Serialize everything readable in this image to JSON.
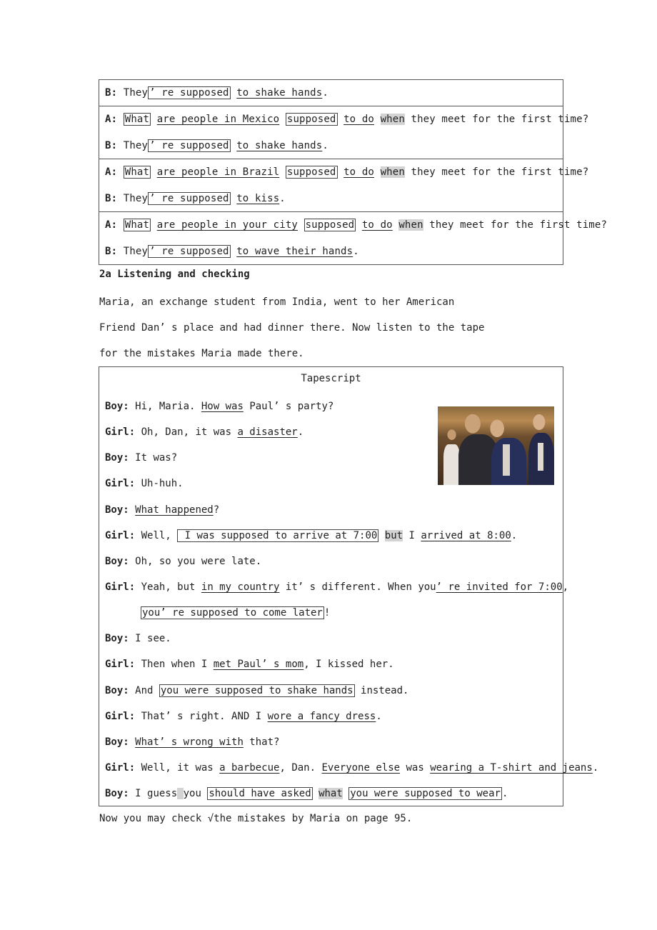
{
  "dialogue_table": {
    "rows": [
      {
        "lines": [
          {
            "speaker": "B:",
            "text": [
              "They",
              "’ re supposed",
              "to shake hands",
              "."
            ]
          }
        ]
      },
      {
        "lines": [
          {
            "speaker": "A:",
            "wh": "What",
            "phrase": "are people in Mexico",
            "supposed": "supposed",
            "todo": "to do",
            "when": "when",
            "rest": "they meet for the first time?"
          },
          {
            "speaker": "B:",
            "text": [
              "They",
              "’ re supposed",
              "to shake hands",
              "."
            ]
          }
        ]
      },
      {
        "lines": [
          {
            "speaker": "A:",
            "wh": "What",
            "phrase": "are people in Brazil",
            "supposed": "supposed",
            "todo": "to do",
            "when": "when",
            "rest": "they meet for the first time?"
          },
          {
            "speaker": "B:",
            "text": [
              "They",
              "’ re supposed",
              "to kiss",
              "."
            ]
          }
        ]
      },
      {
        "lines": [
          {
            "speaker": "A:",
            "wh": "What",
            "phrase": "are people in your city",
            "supposed": "supposed",
            "todo": "to do",
            "when": "when",
            "rest": "they meet for the first time?"
          },
          {
            "speaker": "B:",
            "text": [
              "They",
              "’ re supposed",
              "to wave their hands",
              "."
            ]
          }
        ]
      }
    ]
  },
  "section": {
    "title": "2a Listening and checking",
    "intro_lines": [
      "Maria, an exchange student from India, went to her American",
      "Friend Dan’ s place and had dinner there. Now listen to the tape",
      "for the mistakes Maria made there."
    ]
  },
  "tapescript": {
    "title": "Tapescript",
    "photo_alt": "people-greeting-photo",
    "lines": [
      {
        "speaker": "Boy:",
        "parts": [
          [
            "t",
            "Hi, Maria. "
          ],
          [
            "u",
            "How was"
          ],
          [
            "t",
            " Paul’ s party?"
          ]
        ]
      },
      {
        "speaker": "Girl:",
        "parts": [
          [
            "t",
            "Oh, Dan, it was "
          ],
          [
            "u",
            "a disaster"
          ],
          [
            "t",
            "."
          ]
        ]
      },
      {
        "speaker": "Boy:",
        "parts": [
          [
            "t",
            "It was?"
          ]
        ]
      },
      {
        "speaker": "Girl:",
        "parts": [
          [
            "t",
            "Uh-huh."
          ]
        ]
      },
      {
        "speaker": "Boy:",
        "parts": [
          [
            "u",
            "What happened"
          ],
          [
            "t",
            "?"
          ]
        ]
      },
      {
        "speaker": "Girl:",
        "parts": [
          [
            "t",
            "Well, "
          ],
          [
            "b",
            " I was supposed to arrive at 7:00"
          ],
          [
            "t",
            " "
          ],
          [
            "h",
            "but"
          ],
          [
            "t",
            " I "
          ],
          [
            "u",
            "arrived at 8:00"
          ],
          [
            "t",
            "."
          ]
        ]
      },
      {
        "speaker": "Boy:",
        "parts": [
          [
            "t",
            "Oh, so you were late."
          ]
        ]
      },
      {
        "speaker": "Girl:",
        "parts": [
          [
            "t",
            "Yeah, but "
          ],
          [
            "u",
            "in my country"
          ],
          [
            "t",
            " it’ s different. When you"
          ],
          [
            "u",
            "’ re invited for 7:00"
          ],
          [
            "t",
            ","
          ]
        ]
      },
      {
        "speaker": "",
        "indent": true,
        "parts": [
          [
            "b",
            "you’ re supposed to come later"
          ],
          [
            "t",
            "!"
          ]
        ]
      },
      {
        "speaker": "Boy:",
        "parts": [
          [
            "t",
            "I see."
          ]
        ]
      },
      {
        "speaker": "Girl:",
        "parts": [
          [
            "t",
            "Then when I "
          ],
          [
            "u",
            "met Paul’ s mom"
          ],
          [
            "t",
            ", I kissed her."
          ]
        ]
      },
      {
        "speaker": "Boy:",
        "parts": [
          [
            "t",
            "And "
          ],
          [
            "b",
            "you were supposed to shake hands"
          ],
          [
            "t",
            " instead."
          ]
        ]
      },
      {
        "speaker": "Girl:",
        "parts": [
          [
            "t",
            "That’ s right. AND I "
          ],
          [
            "u",
            "wore a fancy dress"
          ],
          [
            "t",
            "."
          ]
        ]
      },
      {
        "speaker": "Boy:",
        "parts": [
          [
            "u",
            "What’ s wrong with"
          ],
          [
            "t",
            " that?"
          ]
        ]
      },
      {
        "speaker": "Girl:",
        "parts": [
          [
            "t",
            "Well, it was "
          ],
          [
            "u",
            "a barbecue"
          ],
          [
            "t",
            ", Dan. "
          ],
          [
            "u",
            "Everyone else"
          ],
          [
            "t",
            " was "
          ],
          [
            "u",
            "wearing a T-shirt and jeans"
          ],
          [
            "t",
            "."
          ]
        ]
      },
      {
        "speaker": "Boy:",
        "parts": [
          [
            "t",
            "I guess"
          ],
          [
            "h",
            " "
          ],
          [
            "t",
            "you "
          ],
          [
            "b",
            "should have asked"
          ],
          [
            "t",
            " "
          ],
          [
            "h",
            "what"
          ],
          [
            "t",
            " "
          ],
          [
            "b",
            "you were supposed to wear"
          ],
          [
            "t",
            "."
          ]
        ]
      }
    ]
  },
  "footer_note": "Now you may check √the mistakes by Maria on page 95."
}
